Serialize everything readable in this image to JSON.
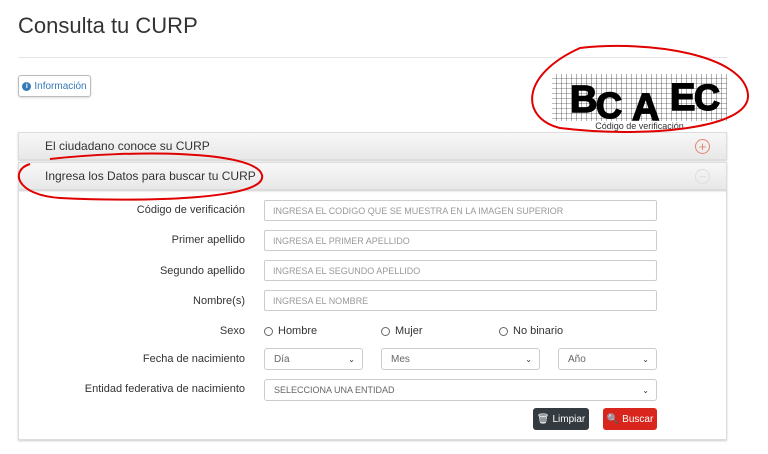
{
  "page": {
    "title": "Consulta tu CURP"
  },
  "info_button": {
    "label": "Información",
    "icon": "info-icon"
  },
  "captcha": {
    "letters": [
      "B",
      "C",
      "A",
      "E",
      "C"
    ],
    "caption": "Código de verificación"
  },
  "panels": [
    {
      "title": "El ciudadano conoce su CURP",
      "icon": "plus-circle-icon",
      "expanded": false
    },
    {
      "title": "Ingresa los Datos para buscar tu CURP",
      "icon": "minus-circle-icon",
      "expanded": true
    }
  ],
  "form": {
    "fields": [
      {
        "label": "Código de verificación",
        "placeholder": "INGRESA EL CODIGO QUE SE MUESTRA EN LA IMAGEN SUPERIOR"
      },
      {
        "label": "Primer apellido",
        "placeholder": "INGRESA EL PRIMER APELLIDO"
      },
      {
        "label": "Segundo apellido",
        "placeholder": "INGRESA EL SEGUNDO APELLIDO"
      },
      {
        "label": "Nombre(s)",
        "placeholder": "INGRESA EL NOMBRE"
      }
    ],
    "sexo": {
      "label": "Sexo",
      "options": [
        "Hombre",
        "Mujer",
        "No binario"
      ]
    },
    "fecha": {
      "label": "Fecha de nacimiento",
      "dia": "Día",
      "mes": "Mes",
      "anio": "Año"
    },
    "entidad": {
      "label": "Entidad federativa de nacimiento",
      "value": "SELECCIONA UNA ENTIDAD"
    },
    "buttons": {
      "limpiar": "Limpiar",
      "buscar": "Buscar"
    }
  },
  "colors": {
    "accent": "#337ab7",
    "danger": "#d9261c",
    "dark": "#333a40",
    "annotation": "#e00000"
  }
}
